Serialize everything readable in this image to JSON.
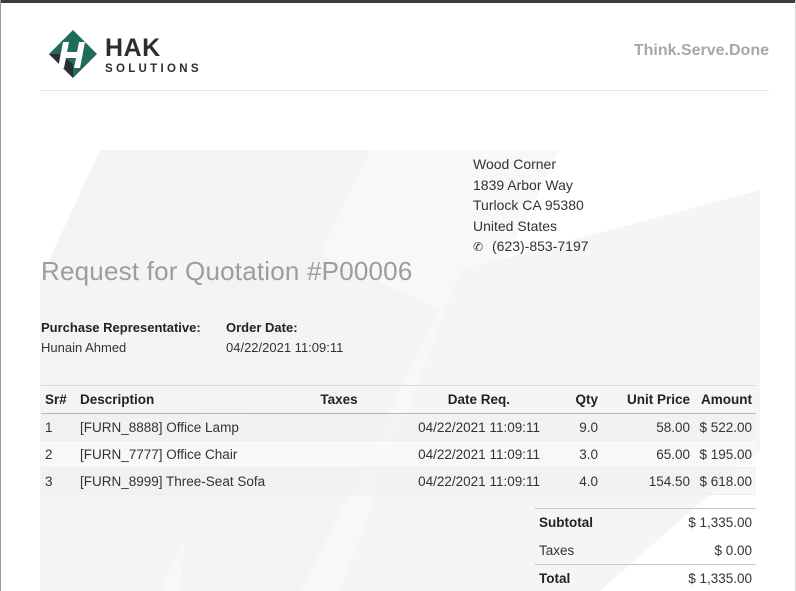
{
  "company": {
    "logo_word": "HAK",
    "logo_sub": "SOLUTIONS",
    "tagline": "Think.Serve.Done",
    "logo_colors": {
      "green": "#1f6b5c",
      "dark": "#2a2d31"
    }
  },
  "vendor_address": {
    "name": "Wood Corner",
    "street": "1839 Arbor Way",
    "city": "Turlock CA 95380",
    "country": "United States",
    "phone": "(623)-853-7197"
  },
  "document": {
    "title": "Request for Quotation #P00006"
  },
  "info": {
    "rep_label": "Purchase Representative:",
    "rep_value": "Hunain Ahmed",
    "date_label": "Order Date:",
    "date_value": "04/22/2021 11:09:11"
  },
  "table": {
    "headers": {
      "sr": "Sr#",
      "description": "Description",
      "taxes": "Taxes",
      "date_req": "Date Req.",
      "qty": "Qty",
      "unit_price": "Unit Price",
      "amount": "Amount"
    },
    "rows": [
      {
        "sr": "1",
        "description": "[FURN_8888] Office Lamp",
        "taxes": "",
        "date_req": "04/22/2021 11:09:11",
        "qty": "9.0",
        "unit_price": "58.00",
        "amount": "$ 522.00"
      },
      {
        "sr": "2",
        "description": "[FURN_7777] Office Chair",
        "taxes": "",
        "date_req": "04/22/2021 11:09:11",
        "qty": "3.0",
        "unit_price": "65.00",
        "amount": "$ 195.00"
      },
      {
        "sr": "3",
        "description": "[FURN_8999] Three-Seat Sofa",
        "taxes": "",
        "date_req": "04/22/2021 11:09:11",
        "qty": "4.0",
        "unit_price": "154.50",
        "amount": "$ 618.00"
      }
    ]
  },
  "totals": {
    "subtotal_label": "Subtotal",
    "subtotal_value": "$ 1,335.00",
    "taxes_label": "Taxes",
    "taxes_value": "$ 0.00",
    "total_label": "Total",
    "total_value": "$ 1,335.00"
  }
}
